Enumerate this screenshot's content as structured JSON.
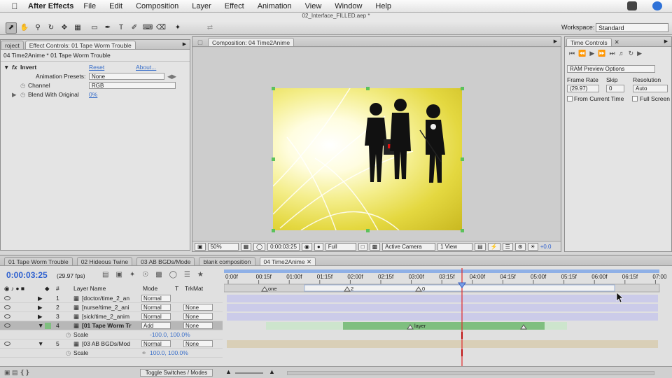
{
  "menubar": {
    "app_name": "After Effects",
    "menus": [
      "File",
      "Edit",
      "Composition",
      "Layer",
      "Effect",
      "Animation",
      "View",
      "Window",
      "Help"
    ]
  },
  "document_title": "02_Interface_FILLED.aep *",
  "toolbar": {
    "workspace_label": "Workspace:",
    "workspace_value": "Standard"
  },
  "effect_panel": {
    "tab_project": "roject",
    "tab_effect": "Effect Controls: 01 Tape Worm Trouble",
    "breadcrumb": "04 Time2Anime * 01 Tape Worm Trouble",
    "effect_name": "Invert",
    "reset": "Reset",
    "about": "About...",
    "presets_label": "Animation Presets:",
    "presets_value": "None",
    "channel_label": "Channel",
    "channel_value": "RGB",
    "blend_label": "Blend With Original",
    "blend_value": "0%"
  },
  "comp_panel": {
    "tab": "Composition: 04 Time2Anime",
    "zoom": "50%",
    "timecode": "0:00:03:25",
    "resolution": "Full",
    "camera": "Active Camera",
    "view": "1 View",
    "exposure": "+0.0"
  },
  "time_panel": {
    "tab": "Time Controls",
    "preview_options": "RAM Preview Options",
    "frame_rate_label": "Frame Rate",
    "frame_rate_value": "(29.97)",
    "skip_label": "Skip",
    "skip_value": "0",
    "resolution_label": "Resolution",
    "resolution_value": "Auto",
    "from_current": "From Current Time",
    "full_screen": "Full Screen"
  },
  "timeline": {
    "tabs": [
      "01 Tape Worm Trouble",
      "02 Hideous Twine",
      "03 AB BGDs/Mode",
      "blank composition",
      "04 Time2Anime"
    ],
    "timecode": "0:00:03:25",
    "fps": "(29.97 fps)",
    "col_number": "#",
    "col_layer_name": "Layer Name",
    "col_mode": "Mode",
    "col_t": "T",
    "col_trkmat": "TrkMat",
    "ruler": [
      "0:00f",
      "00:15f",
      "01:00f",
      "01:15f",
      "02:00f",
      "02:15f",
      "03:00f",
      "03:15f",
      "04:00f",
      "04:15f",
      "05:00f",
      "05:15f",
      "06:00f",
      "06:15f",
      "07:00"
    ],
    "markers": [
      "one",
      "2",
      "0"
    ],
    "layers": [
      {
        "num": "1",
        "name": "[doctor/time_2_an",
        "mode": "Normal",
        "trkmat": ""
      },
      {
        "num": "2",
        "name": "[nurse/time_2_ani",
        "mode": "Normal",
        "trkmat": "None"
      },
      {
        "num": "3",
        "name": "[sick/time_2_anim",
        "mode": "Normal",
        "trkmat": "None"
      },
      {
        "num": "4",
        "name": "[01 Tape Worm Tr",
        "mode": "Add",
        "trkmat": "None"
      },
      {
        "num": "5",
        "name": "[03 AB BGDs/Mod",
        "mode": "Normal",
        "trkmat": "None"
      }
    ],
    "scale_label": "Scale",
    "scale4_value": "-100.0, 100.0%",
    "scale5_value": "100.0, 100.0%",
    "layer_bar_label": "layer",
    "toggle_label": "Toggle Switches / Modes"
  },
  "colors": {
    "accent_blue": "#2c5fcf",
    "playhead": "#e02a2a",
    "layer_bar_green": "#7fbf7f",
    "bg_bar_tan": "#d9cfb7",
    "video_bar_lavender": "#c9c9ea"
  }
}
